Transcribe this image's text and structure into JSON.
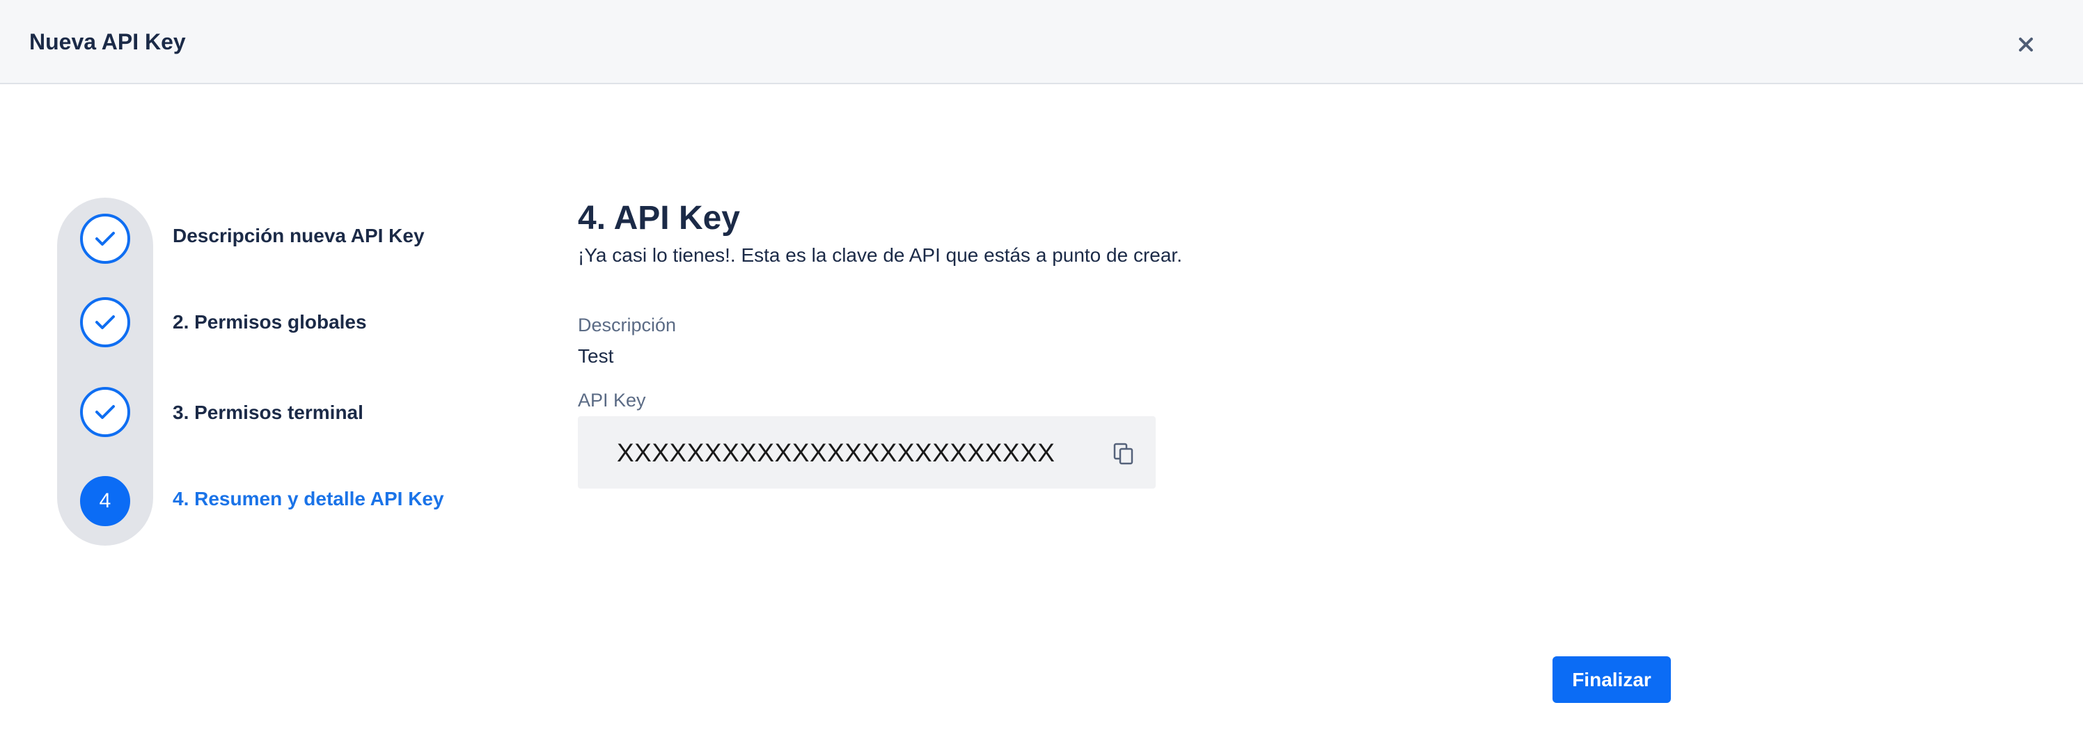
{
  "dialog": {
    "title": "Nueva API Key",
    "close_icon": "close-icon"
  },
  "stepper": {
    "steps": [
      {
        "label": "Descripción nueva API Key",
        "status": "completed",
        "icon": "check-icon"
      },
      {
        "label": "2. Permisos globales",
        "status": "completed",
        "icon": "check-icon"
      },
      {
        "label": "3. Permisos terminal",
        "status": "completed",
        "icon": "check-icon"
      },
      {
        "label": "4. Resumen y detalle API Key",
        "status": "active",
        "number": "4"
      }
    ]
  },
  "main": {
    "title": "4. API Key",
    "subtitle": "¡Ya casi lo tienes!. Esta es la clave de API que estás a punto de crear.",
    "description_label": "Descripción",
    "description_value": "Test",
    "api_key_label": "API Key",
    "api_key_value": "XXXXXXXXXXXXXXXXXXXXXXXXX",
    "copy_icon": "copy-icon"
  },
  "footer": {
    "finish_label": "Finalizar"
  },
  "colors": {
    "primary": "#0b6cf5",
    "header_bg": "#f6f7f9",
    "text_dark": "#1b2a47",
    "text_muted": "#5b6b85",
    "stepper_track": "#e2e4e9",
    "key_box_bg": "#f1f2f4"
  }
}
